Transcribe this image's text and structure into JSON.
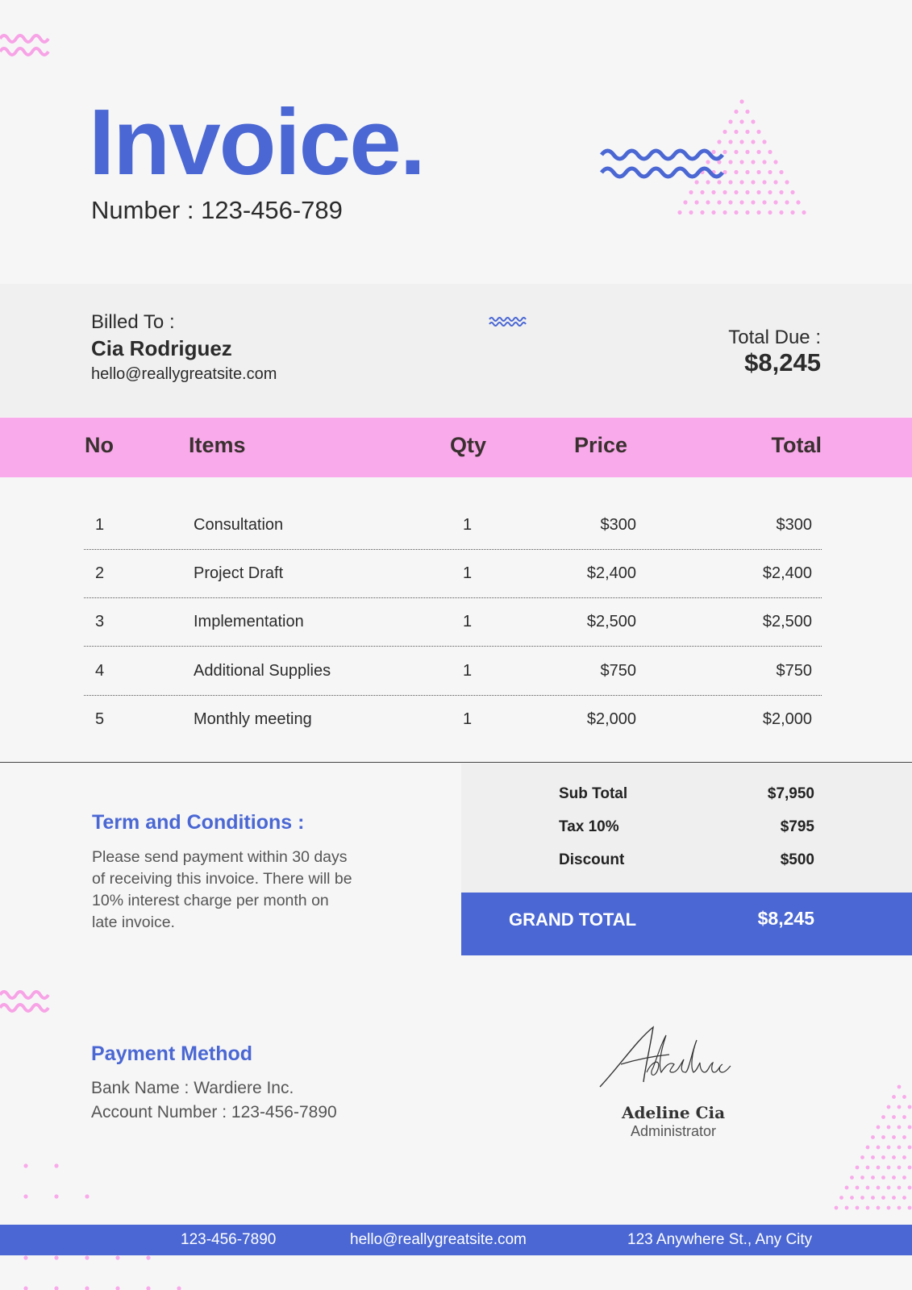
{
  "header": {
    "title": "Invoice.",
    "number_label": "Number : 123-456-789"
  },
  "billed": {
    "label": "Billed To :",
    "name": "Cia Rodriguez",
    "email": "hello@reallygreatsite.com"
  },
  "total_due": {
    "label": "Total Due :",
    "value": "$8,245"
  },
  "table": {
    "headers": {
      "no": "No",
      "items": "Items",
      "qty": "Qty",
      "price": "Price",
      "total": "Total"
    },
    "rows": [
      {
        "no": "1",
        "item": "Consultation",
        "qty": "1",
        "price": "$300",
        "total": "$300"
      },
      {
        "no": "2",
        "item": "Project Draft",
        "qty": "1",
        "price": "$2,400",
        "total": "$2,400"
      },
      {
        "no": "3",
        "item": "Implementation",
        "qty": "1",
        "price": "$2,500",
        "total": "$2,500"
      },
      {
        "no": "4",
        "item": "Additional Supplies",
        "qty": "1",
        "price": "$750",
        "total": "$750"
      },
      {
        "no": "5",
        "item": "Monthly meeting",
        "qty": "1",
        "price": "$2,000",
        "total": "$2,000"
      }
    ]
  },
  "terms": {
    "title": "Term and Conditions :",
    "text": "Please send payment within 30 days of receiving this invoice. There will be 10% interest charge per month on late invoice."
  },
  "summary": {
    "subtotal_label": "Sub Total",
    "subtotal_value": "$7,950",
    "tax_label": "Tax 10%",
    "tax_value": "$795",
    "discount_label": "Discount",
    "discount_value": "$500",
    "grand_label": "GRAND TOTAL",
    "grand_value": "$8,245"
  },
  "payment": {
    "title": "Payment Method",
    "bank": "Bank Name : Wardiere Inc.",
    "account": "Account Number : 123-456-7890"
  },
  "signature": {
    "script": "Adeline",
    "name": "Adeline Cia",
    "role": "Administrator"
  },
  "footer": {
    "phone": "123-456-7890",
    "email": "hello@reallygreatsite.com",
    "address": "123 Anywhere St., Any City"
  },
  "colors": {
    "accent_blue": "#4a67d3",
    "accent_pink": "#f9aaea",
    "background": "#f6f6f7"
  }
}
